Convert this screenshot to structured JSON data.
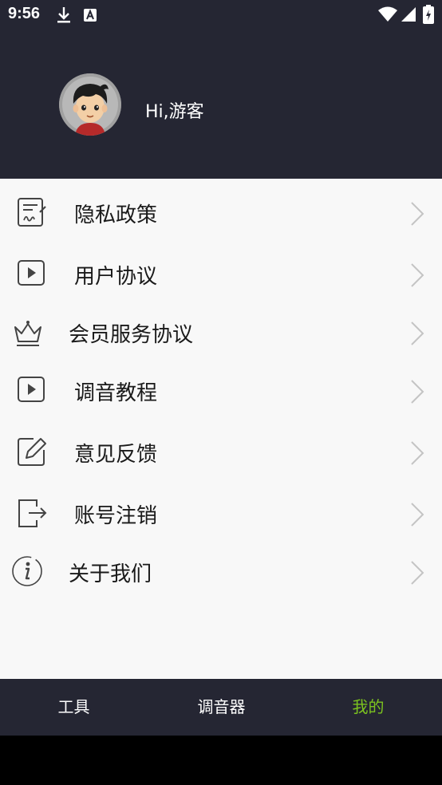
{
  "status_bar": {
    "time": "9:56",
    "left_icons": [
      "download-icon",
      "text-a-icon"
    ],
    "right_icons": [
      "wifi-icon",
      "signal-icon",
      "battery-charging-icon"
    ]
  },
  "profile": {
    "greeting": "Hi,游客",
    "avatar_icon": "cartoon-boy-avatar"
  },
  "menu": {
    "items": [
      {
        "label": "隐私政策",
        "icon": "document-edit-icon"
      },
      {
        "label": "用户协议",
        "icon": "play-book-icon"
      },
      {
        "label": "会员服务协议",
        "icon": "crown-icon"
      },
      {
        "label": "调音教程",
        "icon": "play-book-icon"
      },
      {
        "label": "意见反馈",
        "icon": "pencil-square-icon"
      },
      {
        "label": "账号注销",
        "icon": "logout-icon"
      },
      {
        "label": "关于我们",
        "icon": "info-icon"
      }
    ]
  },
  "tabbar": {
    "tabs": [
      {
        "label": "工具",
        "active": false
      },
      {
        "label": "调音器",
        "active": false
      },
      {
        "label": "我的",
        "active": true
      }
    ]
  },
  "colors": {
    "header_bg": "#252633",
    "menu_bg": "#f8f8f8",
    "active_tab": "#7cc31f",
    "text": "#1a1a1a"
  }
}
